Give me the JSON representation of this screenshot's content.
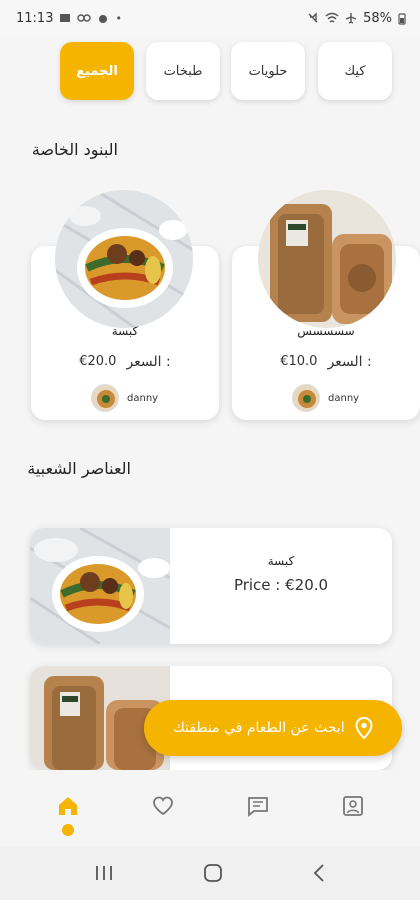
{
  "status_bar": {
    "time": "11:13",
    "battery": "58%"
  },
  "categories": [
    {
      "label": "كيك",
      "active": false
    },
    {
      "label": "حلويات",
      "active": false
    },
    {
      "label": "طبخات",
      "active": false
    },
    {
      "label": "الجميع",
      "active": true
    }
  ],
  "special_section": {
    "title": "البنود الخاصة",
    "items": [
      {
        "name": "سسسسس",
        "price_label": "السعر :",
        "price": "€10.0",
        "owner": "danny"
      },
      {
        "name": "كبسة",
        "price_label": "السعر :",
        "price": "€20.0",
        "owner": "danny"
      }
    ]
  },
  "popular_section": {
    "title": "العناصر الشعبية",
    "items": [
      {
        "name": "كبسة",
        "price": "Price : €20.0"
      }
    ]
  },
  "cta": {
    "label": "ابحث عن الطعام في منطقتك"
  },
  "colors": {
    "accent": "#f5b400"
  },
  "icons": {
    "nav": [
      "home-icon",
      "heart-icon",
      "chat-icon",
      "profile-icon"
    ],
    "system": [
      "recents-icon",
      "home-circle-icon",
      "back-icon"
    ]
  }
}
